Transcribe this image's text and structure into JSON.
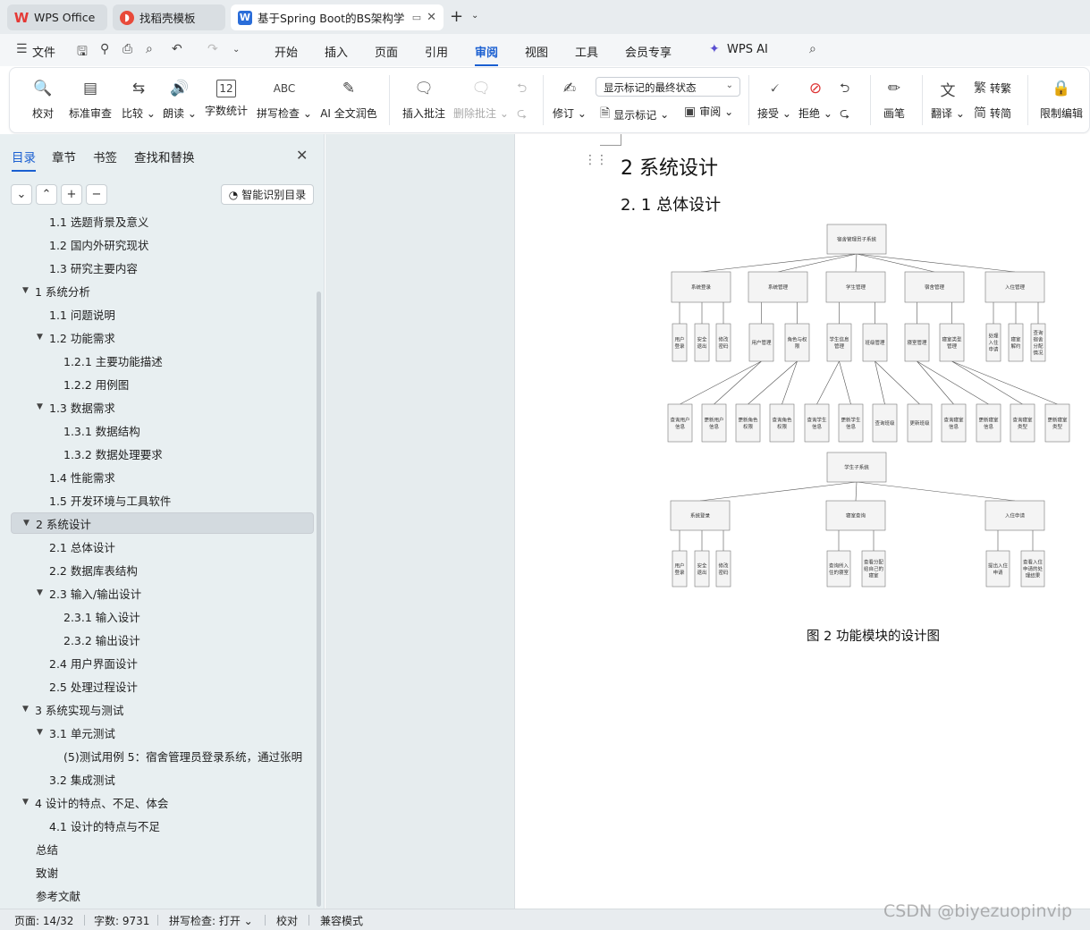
{
  "tabs": [
    {
      "label": "WPS Office",
      "icon": "wps-logo-icon"
    },
    {
      "label": "找稻壳模板",
      "icon": "daoke-logo-icon"
    },
    {
      "label": "基于Spring Boot的BS架构学",
      "icon": "word-doc-icon"
    }
  ],
  "menu": {
    "file": "文件",
    "items": [
      "开始",
      "插入",
      "页面",
      "引用",
      "审阅",
      "视图",
      "工具",
      "会员专享",
      "WPS AI"
    ],
    "active": "审阅"
  },
  "ribbon": {
    "proof": "校对",
    "std_review": "标准审查",
    "compare": "比较",
    "read": "朗读",
    "word_count": "字数统计",
    "spell_check": "拼写检查",
    "ai_polish": "AI 全文润色",
    "insert_comment": "插入批注",
    "delete_comment": "删除批注",
    "revise": "修订",
    "markup_select": "显示标记的最终状态",
    "show_markup": "显示标记",
    "review": "审阅",
    "accept": "接受",
    "reject": "拒绝",
    "brush": "画笔",
    "translate": "翻译",
    "to_traditional": "转繁",
    "to_simplified": "转简",
    "restrict_edit": "限制编辑",
    "icon_abc": "ABC",
    "icon_12": "12"
  },
  "nav": {
    "tabs": [
      "目录",
      "章节",
      "书签",
      "查找和替换"
    ],
    "active_tab": "目录",
    "smart_button": "智能识别目录",
    "toc": [
      {
        "text": "1.1 选题背景及意义",
        "level": 2,
        "arrow": ""
      },
      {
        "text": "1.2 国内外研究现状",
        "level": 2,
        "arrow": ""
      },
      {
        "text": "1.3 研究主要内容",
        "level": 2,
        "arrow": ""
      },
      {
        "text": "1 系统分析",
        "level": 1,
        "arrow": "▼"
      },
      {
        "text": "1.1 问题说明",
        "level": 2,
        "arrow": ""
      },
      {
        "text": "1.2 功能需求",
        "level": 2,
        "arrow": "▼"
      },
      {
        "text": "1.2.1 主要功能描述",
        "level": 3,
        "arrow": ""
      },
      {
        "text": "1.2.2 用例图",
        "level": 3,
        "arrow": ""
      },
      {
        "text": "1.3 数据需求",
        "level": 2,
        "arrow": "▼"
      },
      {
        "text": "1.3.1 数据结构",
        "level": 3,
        "arrow": ""
      },
      {
        "text": "1.3.2 数据处理要求",
        "level": 3,
        "arrow": ""
      },
      {
        "text": "1.4 性能需求",
        "level": 2,
        "arrow": ""
      },
      {
        "text": "1.5 开发环境与工具软件",
        "level": 2,
        "arrow": ""
      },
      {
        "text": "2 系统设计",
        "level": 1,
        "arrow": "▼",
        "selected": true
      },
      {
        "text": "2.1 总体设计",
        "level": 2,
        "arrow": ""
      },
      {
        "text": "2.2 数据库表结构",
        "level": 2,
        "arrow": ""
      },
      {
        "text": "2.3 输入/输出设计",
        "level": 2,
        "arrow": "▼"
      },
      {
        "text": "2.3.1 输入设计",
        "level": 3,
        "arrow": ""
      },
      {
        "text": "2.3.2 输出设计",
        "level": 3,
        "arrow": ""
      },
      {
        "text": "2.4 用户界面设计",
        "level": 2,
        "arrow": ""
      },
      {
        "text": "2.5 处理过程设计",
        "level": 2,
        "arrow": ""
      },
      {
        "text": "3 系统实现与测试",
        "level": 1,
        "arrow": "▼"
      },
      {
        "text": "3.1 单元测试",
        "level": 2,
        "arrow": "▼"
      },
      {
        "text": "(5)测试用例 5：宿舍管理员登录系统，通过张明 ...",
        "level": 3,
        "arrow": ""
      },
      {
        "text": "3.2 集成测试",
        "level": 2,
        "arrow": ""
      },
      {
        "text": "4 设计的特点、不足、体会",
        "level": 1,
        "arrow": "▼"
      },
      {
        "text": "4.1 设计的特点与不足",
        "level": 2,
        "arrow": ""
      },
      {
        "text": "总结",
        "level": 0,
        "arrow": ""
      },
      {
        "text": "致谢",
        "level": 0,
        "arrow": ""
      },
      {
        "text": "参考文献",
        "level": 0,
        "arrow": ""
      }
    ]
  },
  "doc": {
    "h1": "2 系统设计",
    "h2": "2. 1 总体设计",
    "caption": "图 2  功能模块的设计图",
    "diagram": {
      "root1": "宿舍管理员子系统",
      "l1": [
        "系统登录",
        "系统管理",
        "学生管理",
        "宿舍管理",
        "入住管理"
      ],
      "l2": [
        "用户登录",
        "安全退出",
        "修改密码",
        "用户管理",
        "角色与权限",
        "学生信息管理",
        "班级管理",
        "寝室管理",
        "寝室类型管理",
        "处理入住申请",
        "寝室解约",
        "查询宿舍分配情况"
      ],
      "l3": [
        "查询用户信息",
        "更新用户信息",
        "更新角色权限",
        "查询角色权限",
        "查询学生信息",
        "更新学生信息",
        "查询班级",
        "更新班级",
        "查询寝室信息",
        "更新寝室信息",
        "查询寝室类型",
        "更新寝室类型"
      ],
      "root2": "学生子系统",
      "s1": [
        "系统登录",
        "寝室查询",
        "入住申请"
      ],
      "s2": [
        "用户登录",
        "安全退出",
        "修改密码",
        "查询所入住的寝室",
        "查看分配给自己的寝室",
        "提出入住申请",
        "查看入住申请的处理结果"
      ]
    }
  },
  "status": {
    "page": "页面: 14/32",
    "words": "字数: 9731",
    "spell": "拼写检查: 打开",
    "proof": "校对",
    "compat": "兼容模式"
  },
  "watermark": "CSDN @biyezuopinvip"
}
